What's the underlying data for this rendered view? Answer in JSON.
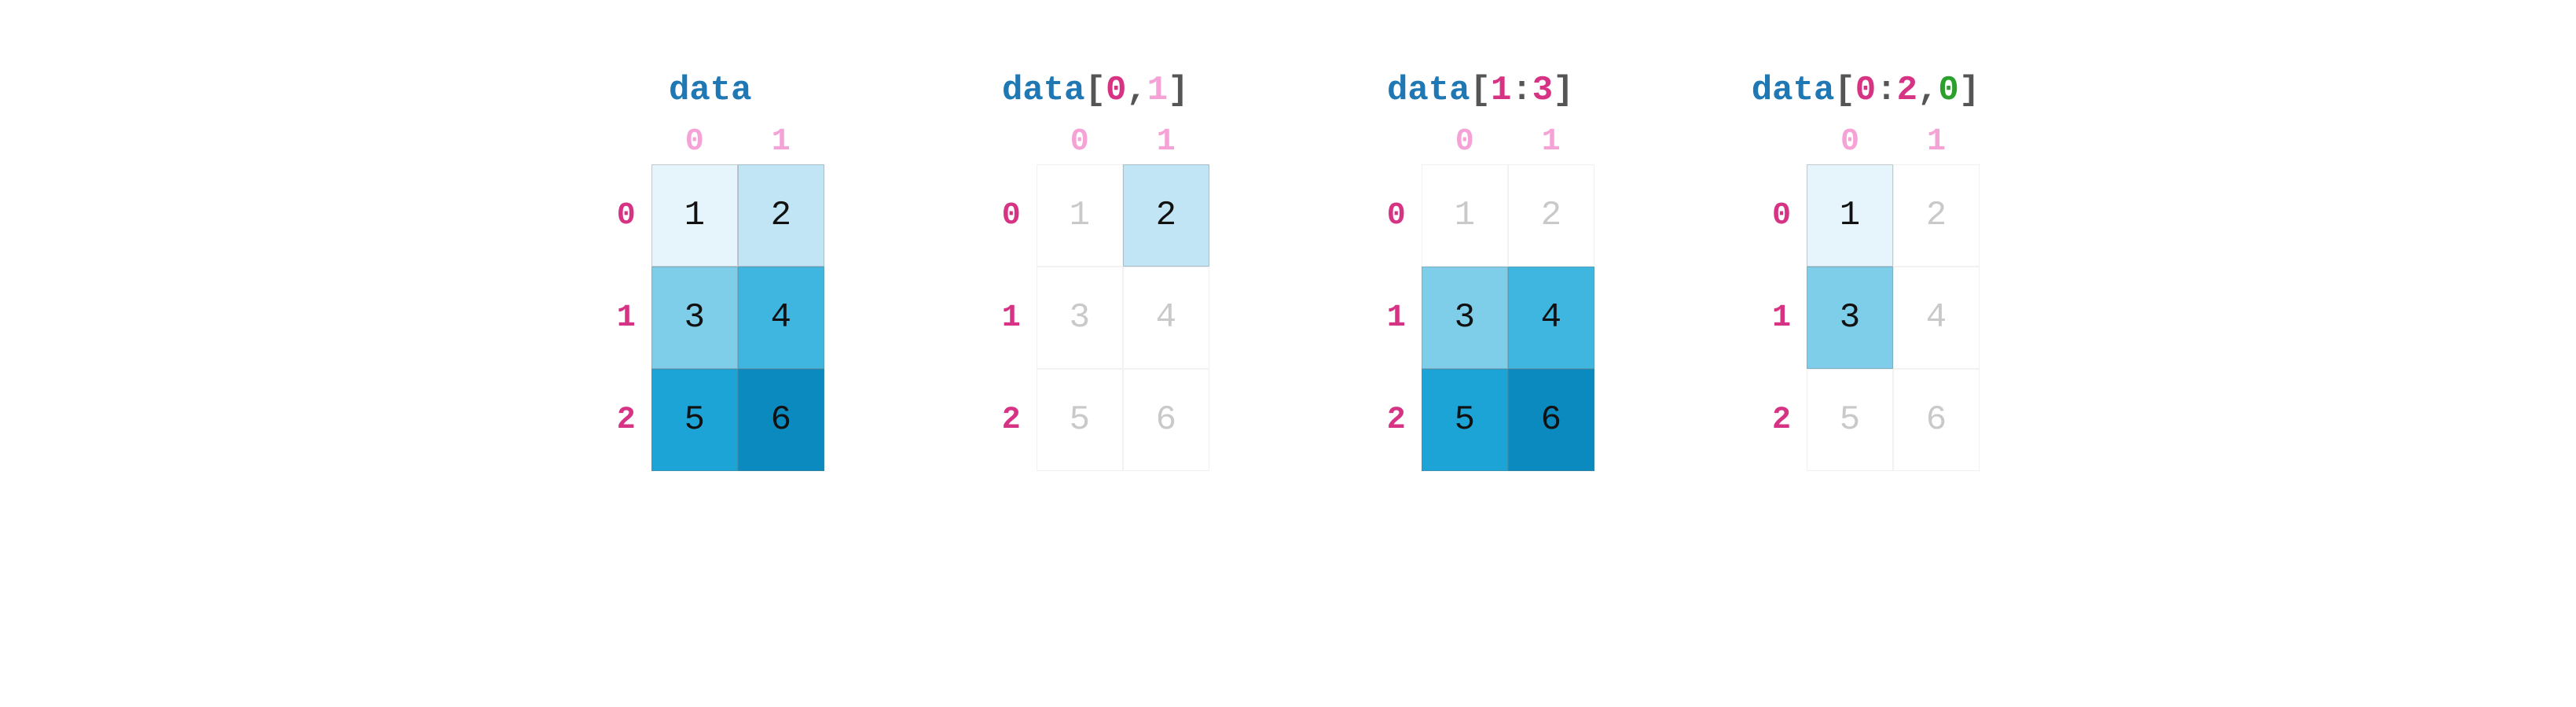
{
  "col_labels": [
    "0",
    "1"
  ],
  "row_labels": [
    "0",
    "1",
    "2"
  ],
  "panels": [
    {
      "title_parts": [
        {
          "text": "data",
          "cls": "t-blue"
        }
      ],
      "cells": [
        {
          "v": "1",
          "active": true,
          "shade": "c1"
        },
        {
          "v": "2",
          "active": true,
          "shade": "c2"
        },
        {
          "v": "3",
          "active": true,
          "shade": "c3"
        },
        {
          "v": "4",
          "active": true,
          "shade": "c4"
        },
        {
          "v": "5",
          "active": true,
          "shade": "c5"
        },
        {
          "v": "6",
          "active": true,
          "shade": "c6"
        }
      ]
    },
    {
      "title_parts": [
        {
          "text": "data",
          "cls": "t-blue"
        },
        {
          "text": "[",
          "cls": "t-gray"
        },
        {
          "text": "0",
          "cls": "t-pink"
        },
        {
          "text": ",",
          "cls": "t-gray"
        },
        {
          "text": "1",
          "cls": "t-plum"
        },
        {
          "text": "]",
          "cls": "t-gray"
        }
      ],
      "cells": [
        {
          "v": "1",
          "active": false
        },
        {
          "v": "2",
          "active": true,
          "shade": "c2"
        },
        {
          "v": "3",
          "active": false
        },
        {
          "v": "4",
          "active": false
        },
        {
          "v": "5",
          "active": false
        },
        {
          "v": "6",
          "active": false
        }
      ]
    },
    {
      "title_parts": [
        {
          "text": "data",
          "cls": "t-blue"
        },
        {
          "text": "[",
          "cls": "t-gray"
        },
        {
          "text": "1",
          "cls": "t-pink"
        },
        {
          "text": ":",
          "cls": "t-gray"
        },
        {
          "text": "3",
          "cls": "t-pink"
        },
        {
          "text": "]",
          "cls": "t-gray"
        }
      ],
      "cells": [
        {
          "v": "1",
          "active": false
        },
        {
          "v": "2",
          "active": false
        },
        {
          "v": "3",
          "active": true,
          "shade": "c3"
        },
        {
          "v": "4",
          "active": true,
          "shade": "c4"
        },
        {
          "v": "5",
          "active": true,
          "shade": "c5"
        },
        {
          "v": "6",
          "active": true,
          "shade": "c6"
        }
      ]
    },
    {
      "title_parts": [
        {
          "text": "data",
          "cls": "t-blue"
        },
        {
          "text": "[",
          "cls": "t-gray"
        },
        {
          "text": "0",
          "cls": "t-pink"
        },
        {
          "text": ":",
          "cls": "t-gray"
        },
        {
          "text": "2",
          "cls": "t-pink"
        },
        {
          "text": ",",
          "cls": "t-gray"
        },
        {
          "text": "0",
          "cls": "t-green"
        },
        {
          "text": "]",
          "cls": "t-gray"
        }
      ],
      "cells": [
        {
          "v": "1",
          "active": true,
          "shade": "c1"
        },
        {
          "v": "2",
          "active": false
        },
        {
          "v": "3",
          "active": true,
          "shade": "c3"
        },
        {
          "v": "4",
          "active": false
        },
        {
          "v": "5",
          "active": false
        },
        {
          "v": "6",
          "active": false
        }
      ]
    }
  ]
}
